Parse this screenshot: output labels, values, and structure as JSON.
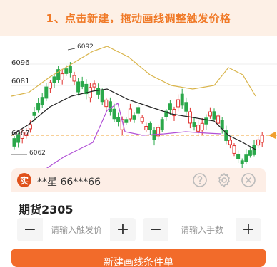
{
  "banner": {
    "text": "1、点击新建，拖动画线调整触发价格"
  },
  "chart": {
    "y_labels": [
      "6096",
      "6081",
      "6067"
    ],
    "high_mark": "6092",
    "low_mark": "6062",
    "colors": {
      "up": "#e0302c",
      "down": "#2aa84a",
      "ma_gold": "#d9b44a",
      "ma_black": "#222222",
      "ma_purple": "#b04fd6",
      "dashed_line": "#f0a030"
    }
  },
  "chart_data": {
    "type": "candlestick",
    "y_axis_labels": [
      6096,
      6081,
      6067
    ],
    "annotated_high": 6092,
    "annotated_low": 6062
  },
  "panel": {
    "sim_badge": "实",
    "account": "**星   66***66",
    "icons": [
      "help-icon",
      "settings-icon",
      "close-icon"
    ],
    "contract": "期货2305",
    "price_input": {
      "placeholder": "请输入触发价",
      "minus": "−",
      "plus": "+"
    },
    "qty_input": {
      "placeholder": "请输入手数",
      "minus": "−",
      "plus": "+"
    },
    "submit_label": "新建画线条件单"
  }
}
